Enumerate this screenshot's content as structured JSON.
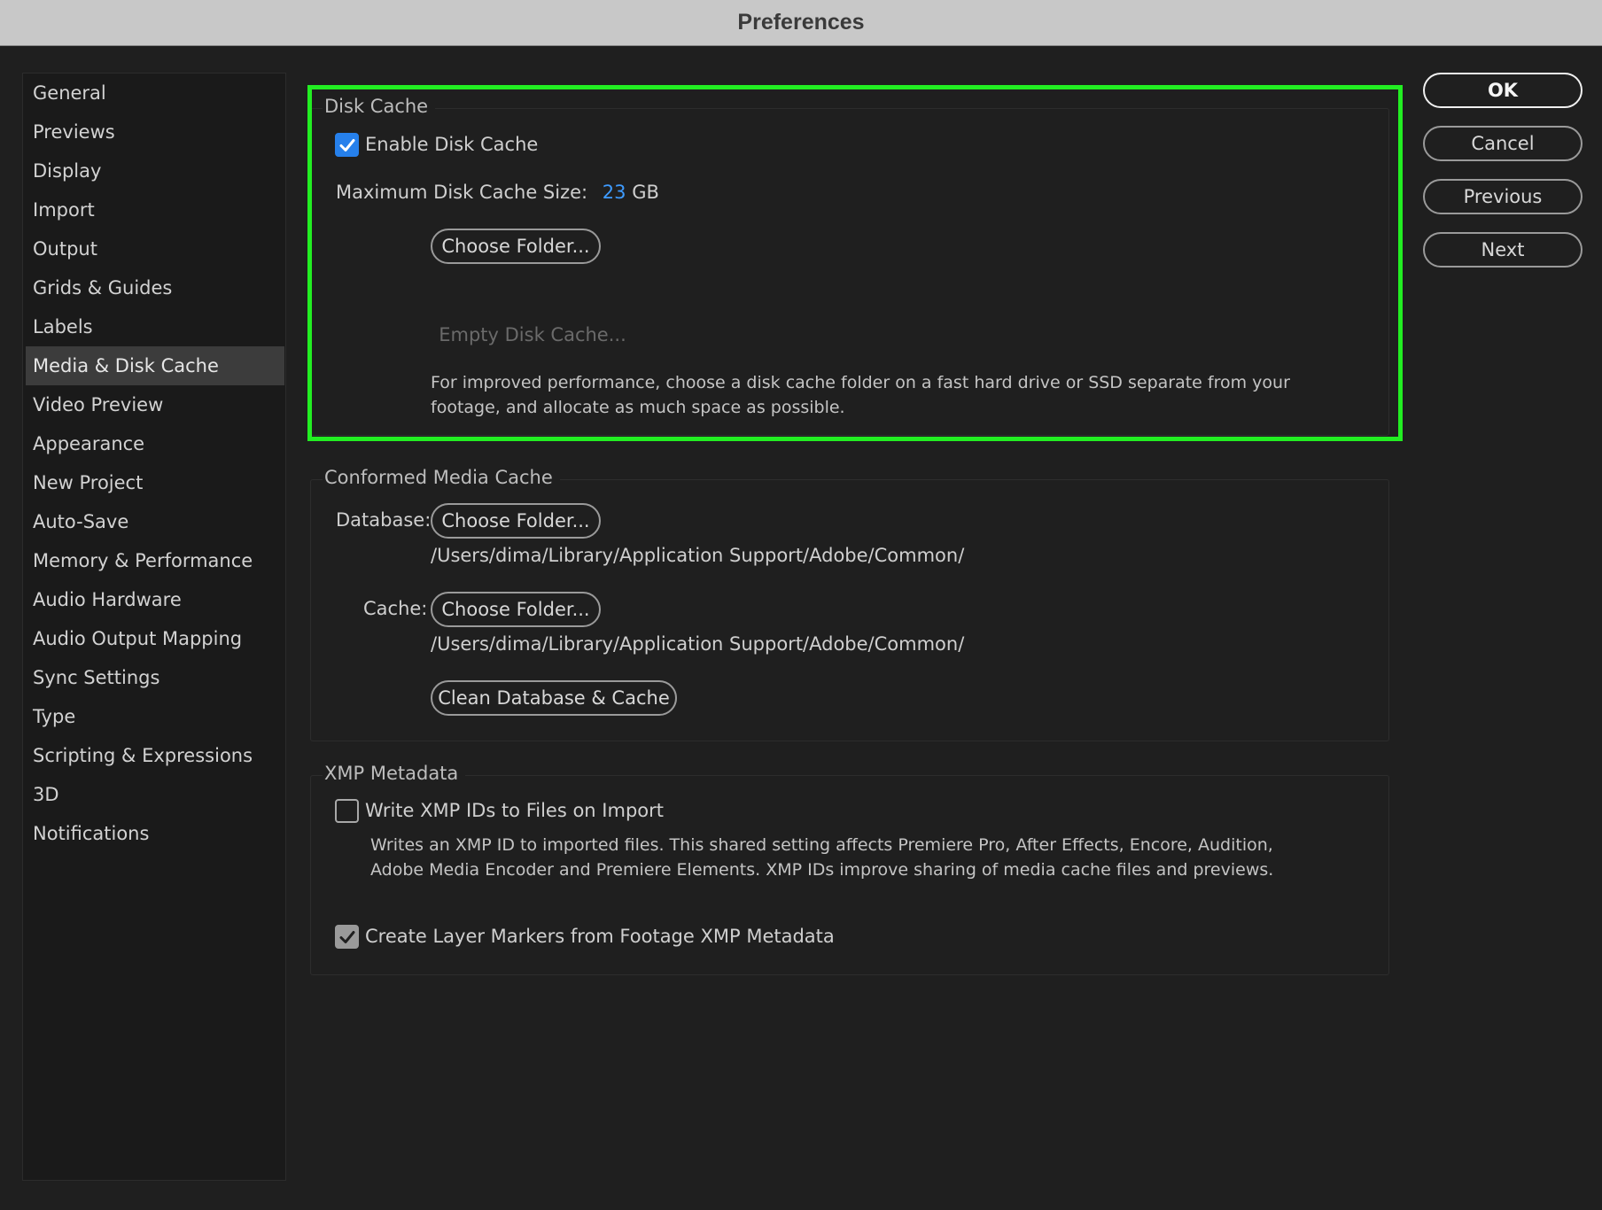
{
  "window": {
    "title": "Preferences"
  },
  "sidebar": {
    "items": [
      {
        "label": "General"
      },
      {
        "label": "Previews"
      },
      {
        "label": "Display"
      },
      {
        "label": "Import"
      },
      {
        "label": "Output"
      },
      {
        "label": "Grids & Guides"
      },
      {
        "label": "Labels"
      },
      {
        "label": "Media & Disk Cache",
        "selected": true
      },
      {
        "label": "Video Preview"
      },
      {
        "label": "Appearance"
      },
      {
        "label": "New Project"
      },
      {
        "label": "Auto-Save"
      },
      {
        "label": "Memory & Performance"
      },
      {
        "label": "Audio Hardware"
      },
      {
        "label": "Audio Output Mapping"
      },
      {
        "label": "Sync Settings"
      },
      {
        "label": "Type"
      },
      {
        "label": "Scripting & Expressions"
      },
      {
        "label": "3D"
      },
      {
        "label": "Notifications"
      }
    ]
  },
  "actions": {
    "ok": "OK",
    "cancel": "Cancel",
    "previous": "Previous",
    "next": "Next"
  },
  "disk_cache": {
    "title": "Disk Cache",
    "enable_label": "Enable Disk Cache",
    "enable_checked": true,
    "max_size_label": "Maximum Disk Cache Size:",
    "max_size_value": "23",
    "max_size_unit": "GB",
    "choose_folder": "Choose Folder...",
    "empty_cache": "Empty Disk Cache...",
    "description": "For improved performance, choose a disk cache folder on a fast hard drive or SSD separate from your footage, and allocate as much space as possible."
  },
  "conformed_media_cache": {
    "title": "Conformed Media Cache",
    "database_label": "Database:",
    "database_choose": "Choose Folder...",
    "database_path": "/Users/dima/Library/Application Support/Adobe/Common/",
    "cache_label": "Cache:",
    "cache_choose": "Choose Folder...",
    "cache_path": "/Users/dima/Library/Application Support/Adobe/Common/",
    "clean": "Clean Database & Cache"
  },
  "xmp_metadata": {
    "title": "XMP Metadata",
    "write_ids_label": "Write XMP IDs to Files on Import",
    "write_ids_checked": false,
    "write_ids_description": "Writes an XMP ID to imported files. This shared setting affects Premiere Pro, After Effects, Encore, Audition, Adobe Media Encoder and Premiere Elements. XMP IDs improve sharing of media cache files and previews.",
    "layer_markers_label": "Create Layer Markers from Footage XMP Metadata",
    "layer_markers_checked": true
  },
  "colors": {
    "accent": "#2680eb",
    "highlight": "#22ee22",
    "value_blue": "#3e9bff"
  }
}
